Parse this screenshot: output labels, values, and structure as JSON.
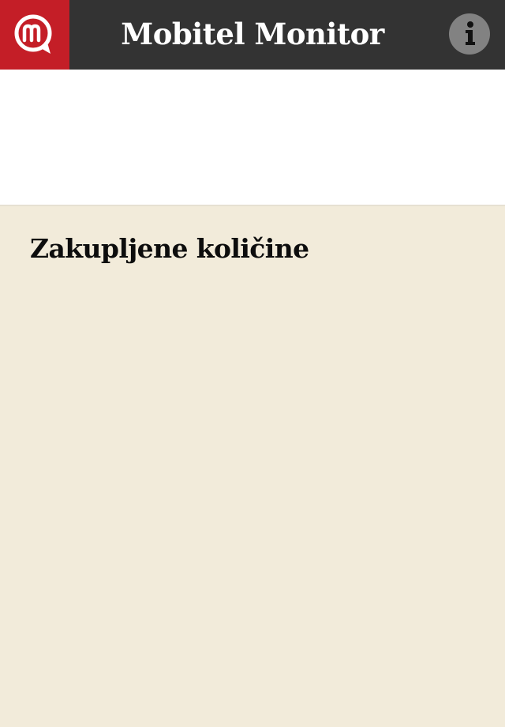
{
  "header": {
    "title": "Mobitel Monitor",
    "logo_icon": "mobitel-logo-icon",
    "info_icon": "info-icon"
  },
  "section": {
    "heading": "Zakupljene količine"
  },
  "colors": {
    "header_background": "#333333",
    "brand_red": "#c41e27",
    "info_button": "#828282",
    "banner_background": "#ffffff",
    "content_background": "#f2ebda"
  }
}
